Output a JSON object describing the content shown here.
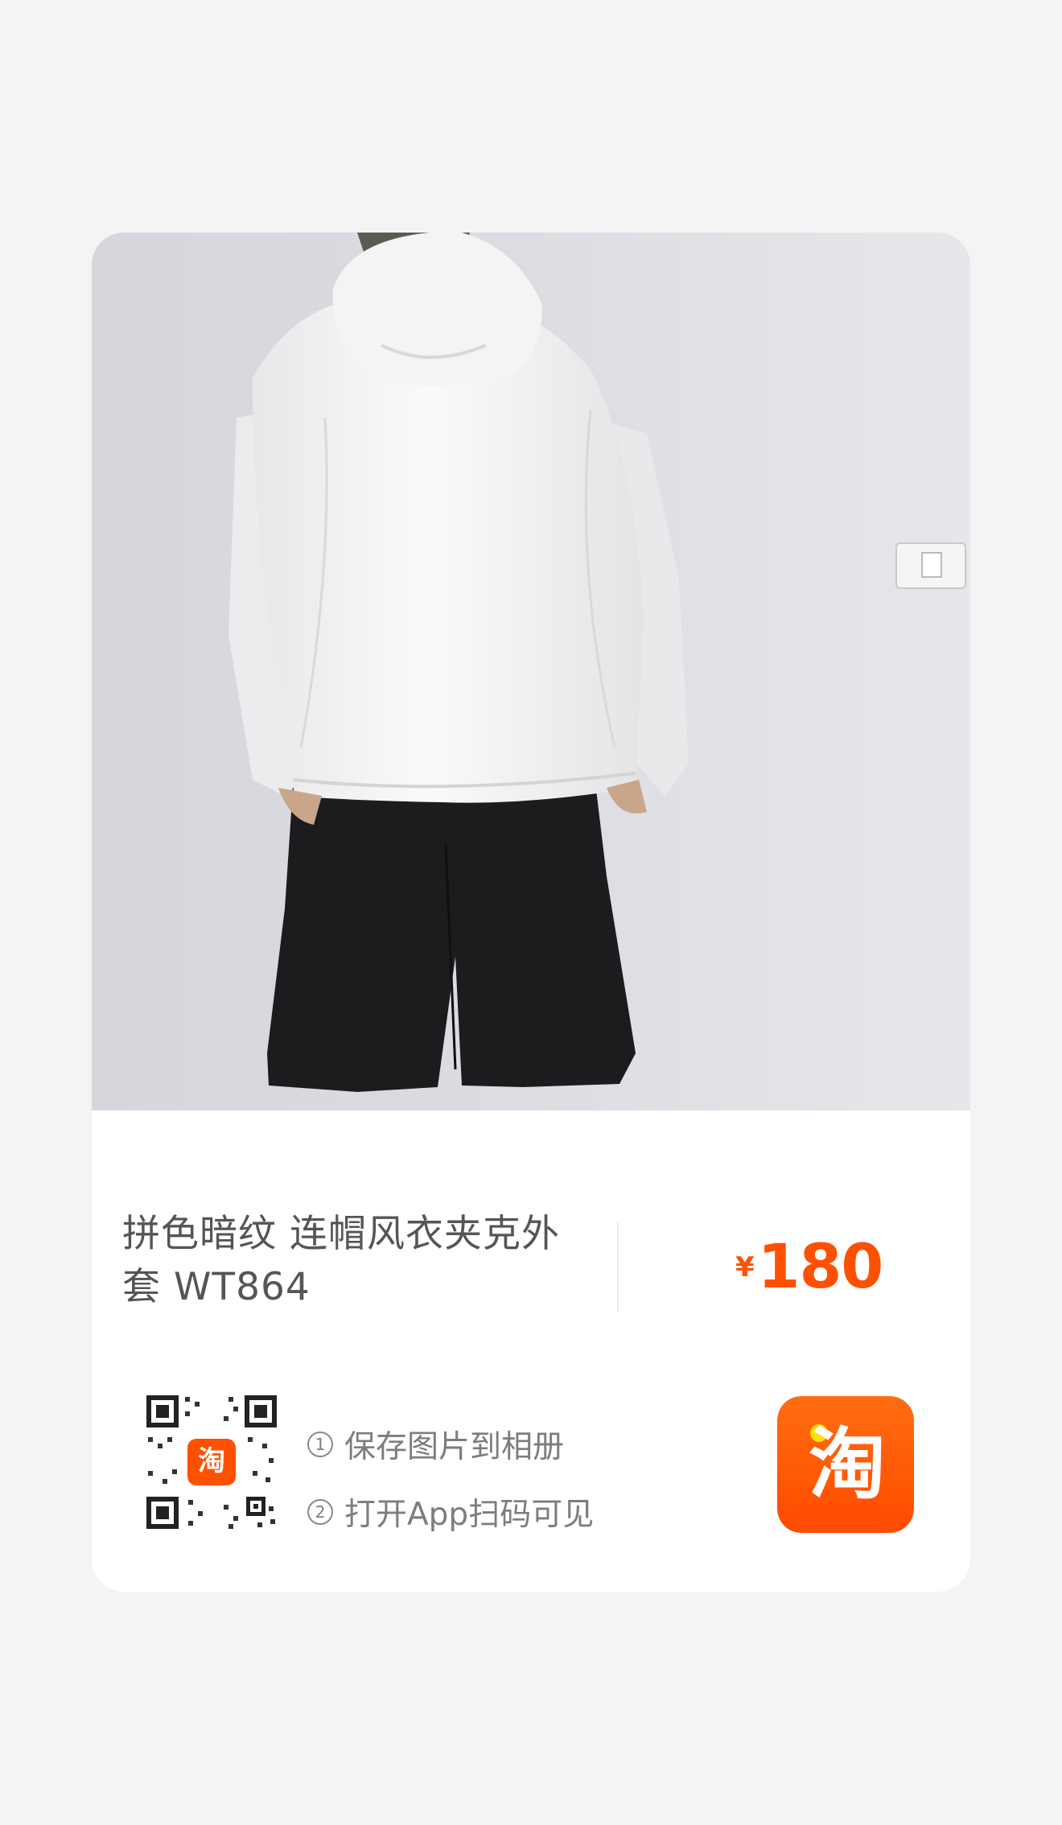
{
  "product": {
    "title": "拼色暗纹 连帽风衣夹克外套 WT864",
    "price_symbol": "¥",
    "price_value": "180"
  },
  "share": {
    "step1_num": "1",
    "step1": "保存图片到相册",
    "step2_num": "2",
    "step2": "打开App扫码可见",
    "qr_badge": "淘",
    "logo_text": "淘"
  },
  "colors": {
    "accent": "#ff5000",
    "page_bg": "#f4f4f4",
    "card_bg": "#ffffff"
  },
  "icons": [
    "qr-code-icon",
    "taobao-app-icon"
  ]
}
